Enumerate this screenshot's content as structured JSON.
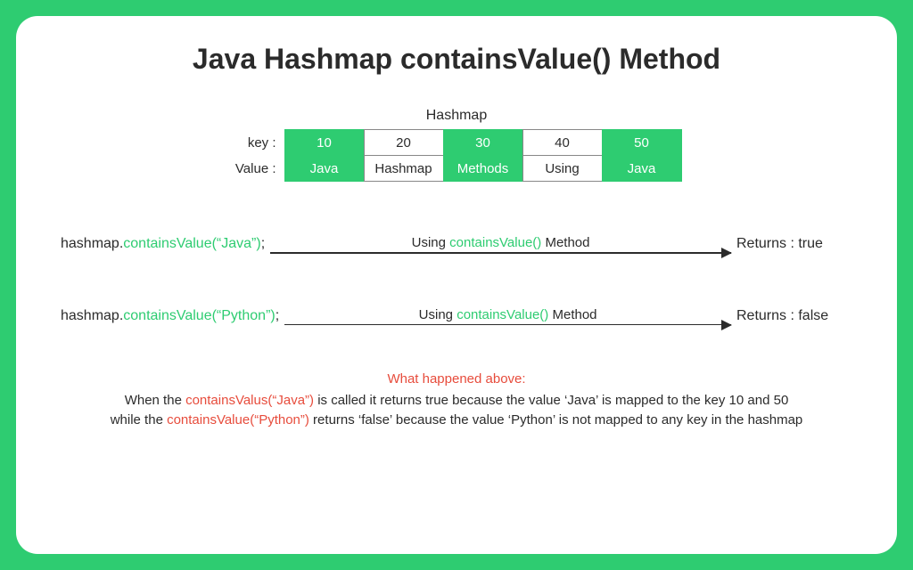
{
  "title": "Java Hashmap containsValue() Method",
  "hashmap": {
    "caption": "Hashmap",
    "keyLabel": "key :",
    "valueLabel": "Value :",
    "keys": [
      "10",
      "20",
      "30",
      "40",
      "50"
    ],
    "values": [
      "Java",
      "Hashmap",
      "Methods",
      "Using",
      "Java"
    ],
    "greenCols": [
      true,
      false,
      true,
      false,
      true
    ]
  },
  "examples": [
    {
      "prefix": "hashmap.",
      "call": "containsValue(“Java”)",
      "suffix": ";",
      "captionPre": "Using ",
      "captionMid": "containsValue()",
      "captionPost": " Method",
      "result": "Returns : true"
    },
    {
      "prefix": "hashmap.",
      "call": "containsValue(“Python”)",
      "suffix": ";",
      "captionPre": "Using ",
      "captionMid": "containsValue()",
      "captionPost": " Method",
      "result": "Returns : false"
    }
  ],
  "footer": {
    "heading": "What happened above:",
    "p1a": "When the ",
    "p1b": "containsValus(“Java”)",
    "p1c": " is called it returns true because the value ‘Java’ is mapped to the key 10 and 50",
    "p2a": "while the ",
    "p2b": "containsValue(“Python”)",
    "p2c": " returns ‘false’ because the value ‘Python’ is not mapped to any key in the hashmap"
  }
}
